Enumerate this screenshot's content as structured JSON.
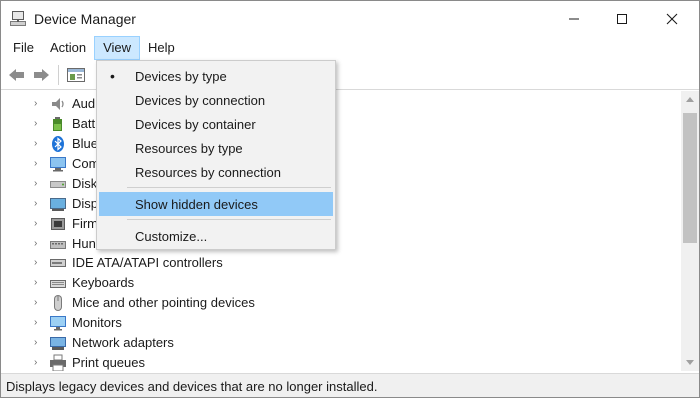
{
  "window": {
    "title": "Device Manager"
  },
  "menubar": {
    "items": [
      {
        "label": "File"
      },
      {
        "label": "Action"
      },
      {
        "label": "View"
      },
      {
        "label": "Help"
      }
    ]
  },
  "view_menu": {
    "items": [
      {
        "label": "Devices by type",
        "checked": true
      },
      {
        "label": "Devices by connection"
      },
      {
        "label": "Devices by container"
      },
      {
        "label": "Resources by type"
      },
      {
        "label": "Resources by connection"
      },
      {
        "label": "Show hidden devices",
        "highlighted": true
      },
      {
        "label": "Customize..."
      }
    ],
    "bullet": "•"
  },
  "tree": {
    "items": [
      {
        "label": "Audio inputs and outputs",
        "visible_label": "Aud",
        "icon": "speaker-icon"
      },
      {
        "label": "Batteries",
        "visible_label": "Batt",
        "icon": "battery-icon"
      },
      {
        "label": "Bluetooth",
        "visible_label": "Blue",
        "icon": "bluetooth-icon"
      },
      {
        "label": "Computer",
        "visible_label": "Com",
        "icon": "computer-icon"
      },
      {
        "label": "Disk drives",
        "visible_label": "Disk",
        "icon": "disk-icon"
      },
      {
        "label": "Display adapters",
        "visible_label": "Disp",
        "icon": "display-adapter-icon"
      },
      {
        "label": "Firmware",
        "visible_label": "Firm",
        "icon": "firmware-icon"
      },
      {
        "label": "Human Interface Devices",
        "visible_label": "Hun",
        "icon": "hid-icon"
      },
      {
        "label": "IDE ATA/ATAPI controllers",
        "visible_label": "IDE ATA/ATAPI controllers",
        "icon": "ide-controller-icon"
      },
      {
        "label": "Keyboards",
        "visible_label": "Keyboards",
        "icon": "keyboard-icon"
      },
      {
        "label": "Mice and other pointing devices",
        "visible_label": "Mice and other pointing devices",
        "icon": "mouse-icon"
      },
      {
        "label": "Monitors",
        "visible_label": "Monitors",
        "icon": "monitor-icon"
      },
      {
        "label": "Network adapters",
        "visible_label": "Network adapters",
        "icon": "network-adapter-icon"
      },
      {
        "label": "Print queues",
        "visible_label": "Print queues",
        "icon": "printer-icon"
      }
    ]
  },
  "statusbar": {
    "text": "Displays legacy devices and devices that are no longer installed."
  },
  "colors": {
    "menu_highlight": "#91c9f7",
    "menubar_active": "#cce8ff",
    "menu_bg": "#f2f2f2",
    "bluetooth": "#1e73d8"
  }
}
